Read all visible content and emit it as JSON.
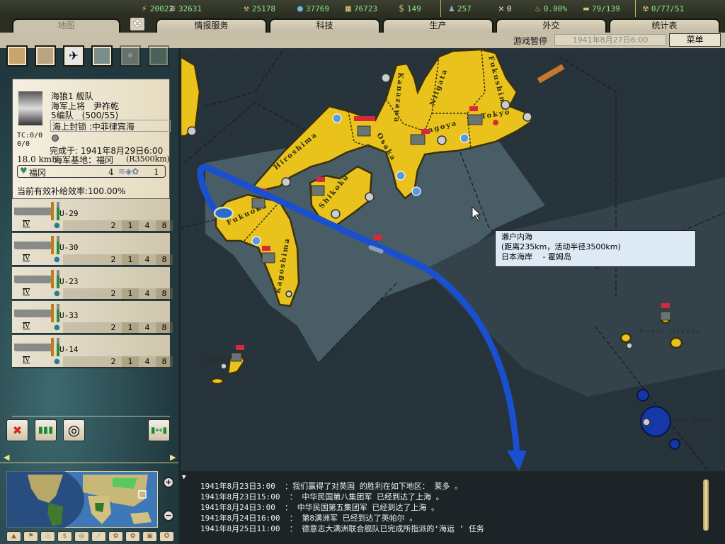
{
  "topbar": {
    "resources": [
      {
        "icon": "energy-icon",
        "glyph": "⚡",
        "value": "20022"
      },
      {
        "icon": "metal-icon",
        "glyph": "⛓",
        "value": "32631"
      },
      {
        "icon": "rare-materials-icon",
        "glyph": "⚒",
        "value": "25178"
      },
      {
        "icon": "oil-icon",
        "glyph": "💧",
        "value": "37769"
      },
      {
        "icon": "supplies-icon",
        "glyph": "▦",
        "value": "76723"
      },
      {
        "icon": "money-icon",
        "glyph": "$",
        "value": "149"
      },
      {
        "icon": "manpower-icon",
        "glyph": "♟",
        "value": "257"
      },
      {
        "icon": "transports-icon",
        "glyph": "✕",
        "value": "0"
      },
      {
        "icon": "dissent-icon",
        "glyph": "♨",
        "value": "0.00%"
      },
      {
        "icon": "convoy-icon",
        "glyph": "▬",
        "value": "79/139"
      },
      {
        "icon": "nukes-icon",
        "glyph": "☢",
        "value": "0/77/51"
      }
    ]
  },
  "tabs": [
    {
      "label": "地图"
    },
    {
      "label": "情报服务"
    },
    {
      "label": "科技"
    },
    {
      "label": "生产"
    },
    {
      "label": "外交"
    },
    {
      "label": "统计表"
    }
  ],
  "status": {
    "paused": "游戏暂停",
    "date": "1941年8月27日6:00",
    "menu": "菜单"
  },
  "fleet": {
    "name": "海狼1 舰队",
    "commander": "海军上将　尹祚乾",
    "divisions": "5编队　(500/55)",
    "mission": "海上封锁 :中菲律宾海",
    "tc": "TC:0/0",
    "tc2": "0/0",
    "completion": "完成于: 1941年8月29日6:00",
    "speed": "18.0 kmh",
    "base": "海军基地：福冈",
    "range": "(R3500km)",
    "location": "福冈",
    "loc_num1": "4",
    "loc_num2": "1",
    "supply": "当前有效补给效率:100.00%"
  },
  "units": [
    {
      "name": "U-29",
      "class": "IV",
      "stats": [
        "2",
        "1",
        "4",
        "8"
      ]
    },
    {
      "name": "U-30",
      "class": "IV",
      "stats": [
        "2",
        "1",
        "4",
        "8"
      ]
    },
    {
      "name": "U-23",
      "class": "IV",
      "stats": [
        "2",
        "1",
        "4",
        "8"
      ]
    },
    {
      "name": "U-33",
      "class": "IV",
      "stats": [
        "2",
        "1",
        "4",
        "8"
      ]
    },
    {
      "name": "U-14",
      "class": "IV",
      "stats": [
        "2",
        "1",
        "4",
        "8"
      ]
    }
  ],
  "map": {
    "labels": [
      "Hiroshima",
      "Osaka",
      "Kanazawa",
      "Niigata",
      "Fukushima",
      "Nagoya",
      "Tokyo",
      "Shikoku",
      "Fukuoka",
      "Kagoshima",
      "Amami",
      "Bonin Islands",
      "Iwo Jima"
    ]
  },
  "tooltip": {
    "line1": "濑户内海",
    "line2": "(距离235km，活动半径3500km)",
    "line3": "日本海岸　 - 霍姆岛"
  },
  "log": [
    {
      "time": "1941年8月23日3:00",
      "text": "：我们赢得了对英国 的胜利在如下地区： 莱多 。"
    },
    {
      "time": "1941年8月23日15:00",
      "text": "： 中华民国第八集团军 已经到达了上海 。"
    },
    {
      "time": "1941年8月24日3:00",
      "text": "： 中华民国第五集团军 已经到达了上海 。"
    },
    {
      "time": "1941年8月24日16:00",
      "text": "： 第8满洲军 已经到达了英帕尔 。"
    },
    {
      "time": "1941年8月25日11:00",
      "text": "： 德意志大满洲联合舰队已完成所指派的‘海运 ’ 任务"
    }
  ],
  "colors": {
    "land": "#e9c31c",
    "sea_deep": "#27343b",
    "sea_shallow": "#4b5f68",
    "route": "#1a4fd0",
    "enemy": "#1438a8"
  }
}
